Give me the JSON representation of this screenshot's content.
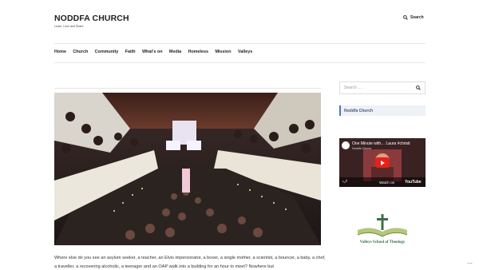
{
  "header": {
    "site_title": "NODDFA CHURCH",
    "tagline": "Learn, Love and Share",
    "search_label": "Search"
  },
  "nav": {
    "items": [
      "Home",
      "Church",
      "Community",
      "Faith",
      "What's on",
      "Media",
      "Homeless",
      "Mission",
      "Valleys"
    ]
  },
  "main": {
    "body_text": "Where else do you see an asylum seeker, a teacher, an Elvis impersonator, a boxer, a single mother, a scientist, a bouncer, a baby, a chef, a traveller, a recovering alcoholic, a teenager and an OAP walk into a building for an hour to meet? Nowhere but"
  },
  "sidebar": {
    "search_placeholder": "Search …",
    "widget_link": "Noddfa Church",
    "video": {
      "title": "One Minute with… Laura #christi",
      "channel": "Noddfa Church",
      "watch_on": "Watch on",
      "platform": "YouTube"
    },
    "logo_text": "Valleys School of Theology"
  },
  "icons": {
    "search": "search-icon",
    "more": "more-options-icon"
  },
  "colors": {
    "accent": "#4a74c9",
    "logo_green": "#3f6f4a",
    "youtube_red": "#e62117"
  }
}
